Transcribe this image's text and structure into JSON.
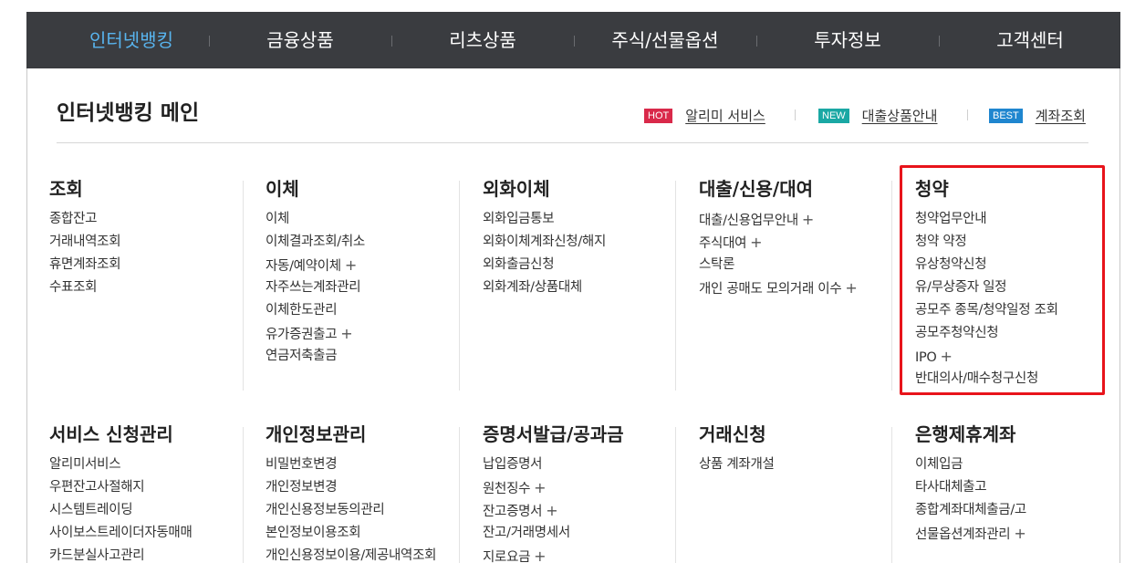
{
  "nav": {
    "items": [
      {
        "label": "인터넷뱅킹",
        "active": true
      },
      {
        "label": "금융상품",
        "active": false
      },
      {
        "label": "리츠상품",
        "active": false
      },
      {
        "label": "주식/선물옵션",
        "active": false
      },
      {
        "label": "투자정보",
        "active": false
      },
      {
        "label": "고객센터",
        "active": false
      }
    ]
  },
  "page": {
    "title": "인터넷뱅킹 메인"
  },
  "quick_links": [
    {
      "badge": "HOT",
      "label": "알리미 서비스"
    },
    {
      "badge": "NEW",
      "label": "대출상품안내"
    },
    {
      "badge": "BEST",
      "label": "계좌조회"
    }
  ],
  "menus_row1": [
    {
      "title": "조회",
      "items": [
        {
          "label": "종합잔고",
          "plus": false
        },
        {
          "label": "거래내역조회",
          "plus": false
        },
        {
          "label": "휴면계좌조회",
          "plus": false
        },
        {
          "label": "수표조회",
          "plus": false
        }
      ]
    },
    {
      "title": "이체",
      "items": [
        {
          "label": "이체",
          "plus": false
        },
        {
          "label": "이체결과조회/취소",
          "plus": false
        },
        {
          "label": "자동/예약이체",
          "plus": true
        },
        {
          "label": "자주쓰는계좌관리",
          "plus": false
        },
        {
          "label": "이체한도관리",
          "plus": false
        },
        {
          "label": "유가증권출고",
          "plus": true
        },
        {
          "label": "연금저축출금",
          "plus": false
        }
      ]
    },
    {
      "title": "외화이체",
      "items": [
        {
          "label": "외화입금통보",
          "plus": false
        },
        {
          "label": "외화이체계좌신청/해지",
          "plus": false
        },
        {
          "label": "외화출금신청",
          "plus": false
        },
        {
          "label": "외화계좌/상품대체",
          "plus": false
        }
      ]
    },
    {
      "title": "대출/신용/대여",
      "items": [
        {
          "label": "대출/신용업무안내",
          "plus": true
        },
        {
          "label": "주식대여",
          "plus": true
        },
        {
          "label": "스탁론",
          "plus": false
        },
        {
          "label": "개인 공매도 모의거래 이수",
          "plus": true
        }
      ]
    },
    {
      "title": "청약",
      "items": [
        {
          "label": "청약업무안내",
          "plus": false
        },
        {
          "label": "청약 약정",
          "plus": false
        },
        {
          "label": "유상청약신청",
          "plus": false
        },
        {
          "label": "유/무상증자 일정",
          "plus": false
        },
        {
          "label": "공모주 종목/청약일정 조회",
          "plus": false
        },
        {
          "label": "공모주청약신청",
          "plus": false
        },
        {
          "label": "IPO",
          "plus": true
        },
        {
          "label": "반대의사/매수청구신청",
          "plus": false
        }
      ]
    }
  ],
  "menus_row2": [
    {
      "title": "서비스 신청관리",
      "items": [
        {
          "label": "알리미서비스",
          "plus": false
        },
        {
          "label": "우편잔고사절해지",
          "plus": false
        },
        {
          "label": "시스템트레이딩",
          "plus": false
        },
        {
          "label": "사이보스트레이더자동매매",
          "plus": false
        },
        {
          "label": "카드분실사고관리",
          "plus": false
        }
      ]
    },
    {
      "title": "개인정보관리",
      "items": [
        {
          "label": "비밀번호변경",
          "plus": false
        },
        {
          "label": "개인정보변경",
          "plus": false
        },
        {
          "label": "개인신용정보동의관리",
          "plus": false
        },
        {
          "label": "본인정보이용조회",
          "plus": false
        },
        {
          "label": "개인신용정보이용/제공내역조회",
          "plus": false
        }
      ]
    },
    {
      "title": "증명서발급/공과금",
      "items": [
        {
          "label": "납입증명서",
          "plus": false
        },
        {
          "label": "원천징수",
          "plus": true
        },
        {
          "label": "잔고증명서",
          "plus": true
        },
        {
          "label": "잔고/거래명세서",
          "plus": false
        },
        {
          "label": "지로요금",
          "plus": true
        }
      ]
    },
    {
      "title": "거래신청",
      "items": [
        {
          "label": "상품 계좌개설",
          "plus": false
        }
      ]
    },
    {
      "title": "은행제휴계좌",
      "items": [
        {
          "label": "이체입금",
          "plus": false
        },
        {
          "label": "타사대체출고",
          "plus": false
        },
        {
          "label": "종합계좌대체출금/고",
          "plus": false
        },
        {
          "label": "선물옵션계좌관리",
          "plus": true
        }
      ]
    }
  ],
  "plus_symbol": "+",
  "colors": {
    "nav_bg": "#3a3c40",
    "nav_active": "#58b4ee",
    "hot": "#d9294a",
    "new": "#1aa8a4",
    "best": "#1f86cf",
    "highlight": "#e8141b"
  }
}
